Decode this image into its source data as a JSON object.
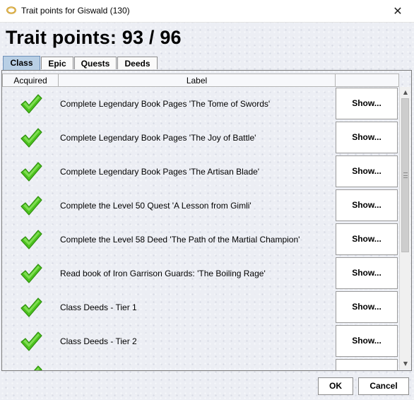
{
  "window": {
    "title": "Trait points for Giswald (130)",
    "close_glyph": "✕"
  },
  "heading": "Trait points: 93 / 96",
  "tabs": [
    {
      "label": "Class",
      "active": true
    },
    {
      "label": "Epic",
      "active": false
    },
    {
      "label": "Quests",
      "active": false
    },
    {
      "label": "Deeds",
      "active": false
    }
  ],
  "table": {
    "columns": [
      "Acquired",
      "Label",
      ""
    ],
    "rows": [
      {
        "acquired": true,
        "label": "Complete Legendary Book Pages 'The Tome of Swords'",
        "action": "Show..."
      },
      {
        "acquired": true,
        "label": "Complete Legendary Book Pages 'The Joy of Battle'",
        "action": "Show..."
      },
      {
        "acquired": true,
        "label": "Complete Legendary Book Pages 'The Artisan Blade'",
        "action": "Show..."
      },
      {
        "acquired": true,
        "label": "Complete the Level 50 Quest 'A Lesson from Gimli'",
        "action": "Show..."
      },
      {
        "acquired": true,
        "label": "Complete the Level 58 Deed 'The Path of the Martial Champion'",
        "action": "Show..."
      },
      {
        "acquired": true,
        "label": "Read book of Iron Garrison Guards: 'The Boiling Rage'",
        "action": "Show..."
      },
      {
        "acquired": true,
        "label": "Class Deeds - Tier 1",
        "action": "Show..."
      },
      {
        "acquired": true,
        "label": "Class Deeds - Tier 2",
        "action": "Show..."
      },
      {
        "acquired": true,
        "label": "",
        "action": ""
      }
    ]
  },
  "footer": {
    "ok_label": "OK",
    "cancel_label": "Cancel"
  },
  "icons": {
    "app": "ring-icon",
    "check": "checkmark-icon"
  },
  "colors": {
    "check_green": "#4cc21e",
    "tab_active": "#b8cfe5"
  }
}
